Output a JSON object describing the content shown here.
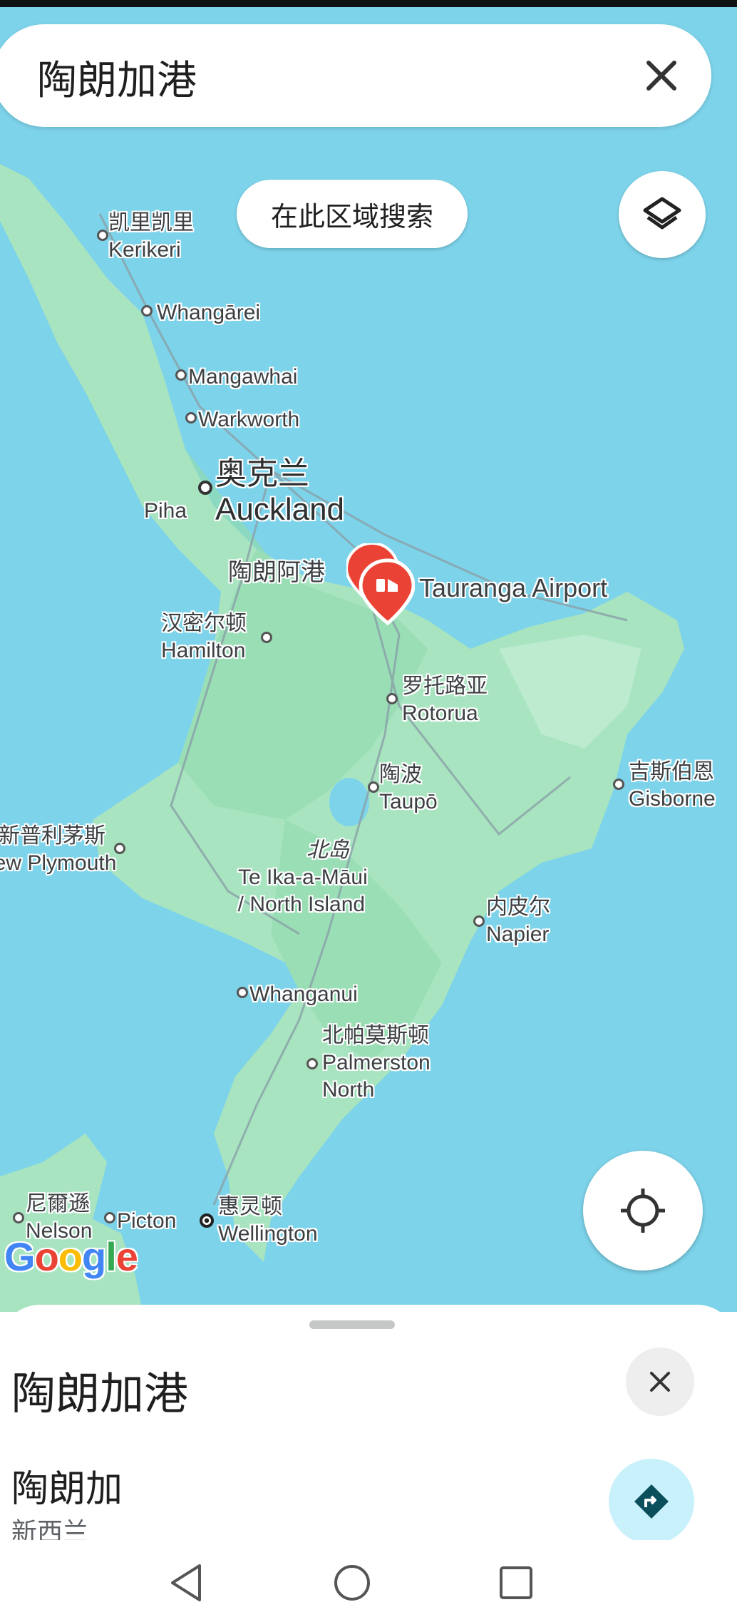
{
  "search": {
    "query": "陶朗加港"
  },
  "map": {
    "search_area_label": "在此区域搜索",
    "labels": {
      "kerikeri_zh": "凯里凯里",
      "kerikeri": "Kerikeri",
      "whangarei": "Whangārei",
      "mangawhai": "Mangawhai",
      "warkworth": "Warkworth",
      "auckland_zh": "奥克兰",
      "auckland": "Auckland",
      "piha": "Piha",
      "tauranga_zh": "陶朗阿港",
      "tauranga_airport": "Tauranga Airport",
      "hamilton_zh": "汉密尔顿",
      "hamilton": "Hamilton",
      "rotorua_zh": "罗托路亚",
      "rotorua": "Rotorua",
      "taupo_zh": "陶波",
      "taupo": "Taupō",
      "gisborne_zh": "吉斯伯恩",
      "gisborne": "Gisborne",
      "newplymouth_zh": "新普利茅斯",
      "newplymouth": "New Plymouth",
      "northisland_zh": "北岛",
      "northisland_1": "Te Ika-a-Māui",
      "northisland_2": "/ North Island",
      "napier_zh": "内皮尔",
      "napier": "Napier",
      "whanganui": "Whanganui",
      "palmerston_zh": "北帕莫斯顿",
      "palmerston_1": "Palmerston",
      "palmerston_2": "North",
      "nelson_zh": "尼爾遜",
      "nelson": "Nelson",
      "picton": "Picton",
      "wellington_zh": "惠灵顿",
      "wellington": "Wellington"
    },
    "logo": "Google",
    "colors": {
      "water": "#7dd3ea",
      "land": "#a8e4c0",
      "pin": "#ea4335"
    }
  },
  "sheet": {
    "title": "陶朗加港",
    "result": {
      "name": "陶朗加",
      "subtitle": "新西兰"
    }
  },
  "icons": {
    "search_close": "close-icon",
    "layers": "layers-icon",
    "locate": "my-location-icon",
    "directions": "directions-icon",
    "nav_back": "back-triangle-icon",
    "nav_home": "home-circle-icon",
    "nav_recents": "recents-square-icon"
  }
}
